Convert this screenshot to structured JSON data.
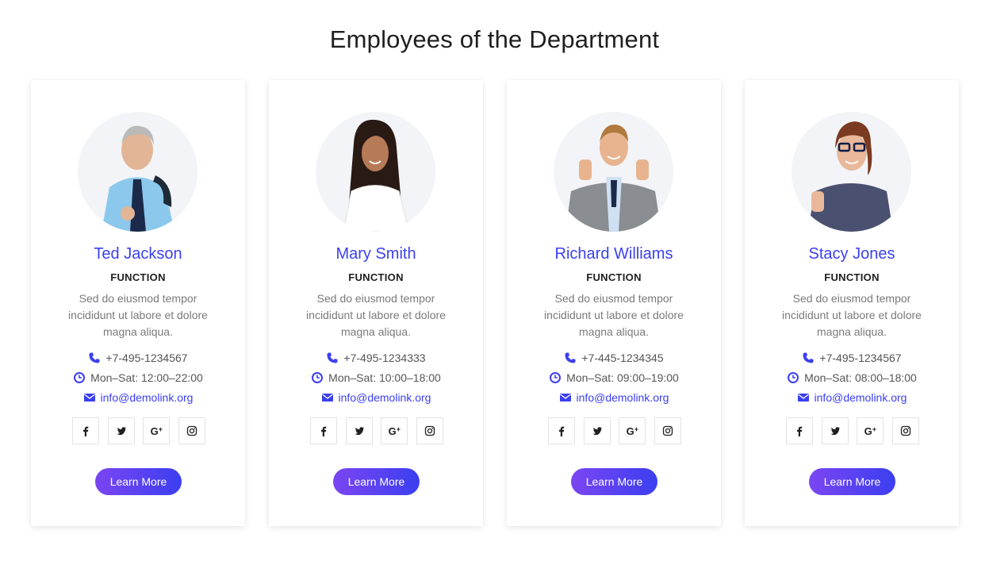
{
  "page": {
    "title": "Employees of the Department"
  },
  "colors": {
    "accent": "#3b3ff0",
    "button_gradient_start": "#7b45f2",
    "button_gradient_end": "#3b3ff0"
  },
  "employees": [
    {
      "name": "Ted Jackson",
      "function": "FUNCTION",
      "description": "Sed do eiusmod tempor incididunt ut labore et dolore magna aliqua.",
      "phone": "+7-495-1234567",
      "hours": "Mon–Sat: 12:00–22:00",
      "email": "info@demolink.org",
      "button_label": "Learn More",
      "photo_icon": "man-gray-hair-photo"
    },
    {
      "name": "Mary Smith",
      "function": "FUNCTION",
      "description": "Sed do eiusmod tempor incididunt ut labore et dolore magna aliqua.",
      "phone": "+7-495-1234333",
      "hours": "Mon–Sat: 10:00–18:00",
      "email": "info@demolink.org",
      "button_label": "Learn More",
      "photo_icon": "woman-dark-hair-photo"
    },
    {
      "name": "Richard Williams",
      "function": "FUNCTION",
      "description": "Sed do eiusmod tempor incididunt ut labore et dolore magna aliqua.",
      "phone": "+7-445-1234345",
      "hours": "Mon–Sat: 09:00–19:00",
      "email": "info@demolink.org",
      "button_label": "Learn More",
      "photo_icon": "man-thumbs-up-photo"
    },
    {
      "name": "Stacy Jones",
      "function": "FUNCTION",
      "description": "Sed do eiusmod tempor incididunt ut labore et dolore magna aliqua.",
      "phone": "+7-495-1234567",
      "hours": "Mon–Sat: 08:00–18:00",
      "email": "info@demolink.org",
      "button_label": "Learn More",
      "photo_icon": "woman-glasses-photo"
    }
  ],
  "social": [
    "facebook-icon",
    "twitter-icon",
    "google-plus-icon",
    "instagram-icon"
  ]
}
